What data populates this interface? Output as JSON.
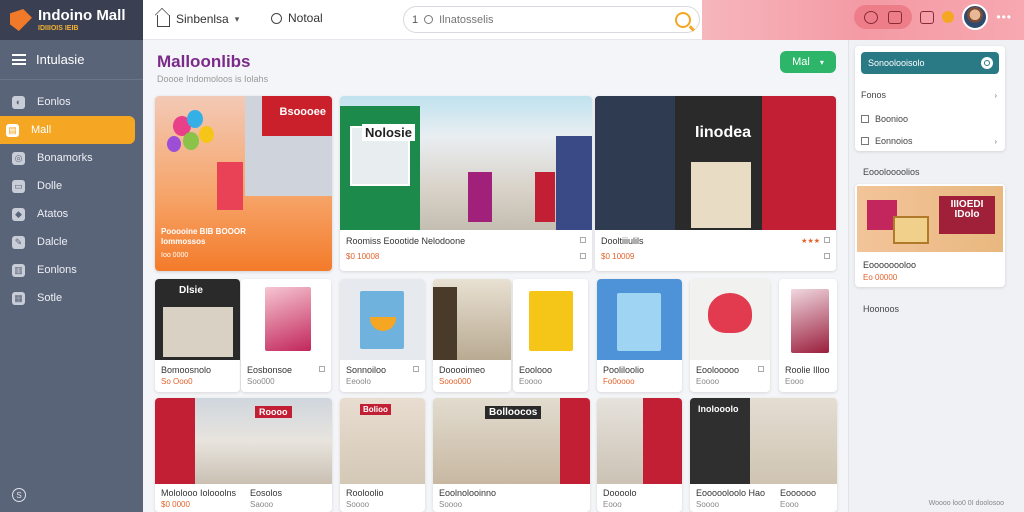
{
  "brand": {
    "name": "Indoino Mall",
    "sub": "IDIIIOIS IEIB"
  },
  "sidebar": {
    "header": "Intulasie",
    "items": [
      {
        "label": "Eonlos",
        "icon": "dashboard-icon"
      },
      {
        "label": "Mall",
        "icon": "store-icon",
        "active": true
      },
      {
        "label": "Bonamorks",
        "icon": "bookmark-icon"
      },
      {
        "label": "Dolle",
        "icon": "document-icon"
      },
      {
        "label": "Atatos",
        "icon": "tag-icon"
      },
      {
        "label": "Dalcle",
        "icon": "pen-icon"
      },
      {
        "label": "Eonlons",
        "icon": "chart-icon"
      },
      {
        "label": "Sotle",
        "icon": "building-icon"
      }
    ]
  },
  "topbar": {
    "home_label": "Sinbenlsa",
    "notif_label": "Notoal",
    "search_prefix": "1",
    "search_placeholder": "Ilnatosselis"
  },
  "main": {
    "title": "Malloonlibs",
    "subtitle": "Doooe Indomoloos is Iolahs",
    "action_label": "Mal",
    "featured": {
      "title": "Pooooine BIB BOOOR Iommossos",
      "price": "Ioo 0000",
      "banner": "Bsoooee"
    },
    "hero_cards": [
      {
        "title": "Roomiss Eoootide Nelodoone",
        "price": "$0 10008",
        "sign": "Nolosie"
      },
      {
        "title": "Dooltiiiulils",
        "price": "$0 10009",
        "sign": "Iinodea"
      }
    ],
    "row1": [
      {
        "title": "Bomoosnolo",
        "price": "So Ooo0",
        "sign": "Dlsie"
      },
      {
        "title": "Eosbonsoe",
        "price": "Soo000"
      },
      {
        "title": "Sonnoiloo",
        "price": "Eeoolo"
      },
      {
        "title": "Dooooimeo",
        "price": "Sooo000"
      },
      {
        "title": "Eoolooo",
        "price": "Eoooo"
      },
      {
        "title": "Pooliloolio",
        "price": "Fo0oooo"
      },
      {
        "title": "Eoolooooo",
        "price": "Eoooo"
      },
      {
        "title": "Roolie Illoo",
        "price": "Eooo"
      }
    ],
    "row2": [
      {
        "title": "Mololooo Iolooolns",
        "price": "$0 0000",
        "sign": "Roooo"
      },
      {
        "title": "Eosolos",
        "price": "Saooo"
      },
      {
        "title": "Rooloolio",
        "price": "Soooo",
        "sign": "Bolioo"
      },
      {
        "title": "Eoolnolooinno",
        "price": "Soooo",
        "sign": "Bolloocos"
      },
      {
        "title": "Doooolo",
        "price": "Eooo"
      },
      {
        "title": "Eoooooloolo Hao",
        "price": "Soooo",
        "sign": "Inolooolo"
      },
      {
        "title": "Eoooooo",
        "price": "Eooo"
      }
    ]
  },
  "rpanel": {
    "filter_title": "Sonoolooisolo",
    "filter_rows": [
      "Fonos",
      "Boonioo",
      "Eonnoios"
    ],
    "section1": "Eoooloooolios",
    "promo": {
      "title": "Eoooooooloo",
      "price": "Eo 00000",
      "sign": "IIIOEDI IDolo"
    },
    "section2": "Hoonoos",
    "footnote": "Woooo loo0 0I doolosoo"
  },
  "colors": {
    "accent": "#f5a623",
    "sidebar": "#5a6478",
    "title": "#7b2a8a",
    "green": "#2db56a",
    "teal": "#2a7a86"
  }
}
